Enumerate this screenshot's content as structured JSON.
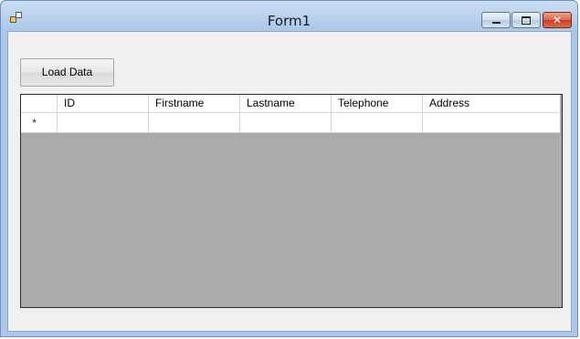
{
  "window": {
    "title": "Form1"
  },
  "toolbar": {
    "load_label": "Load Data"
  },
  "grid": {
    "columns": [
      "ID",
      "Firstname",
      "Lastname",
      "Telephone",
      "Address"
    ],
    "new_row_marker": "*"
  }
}
